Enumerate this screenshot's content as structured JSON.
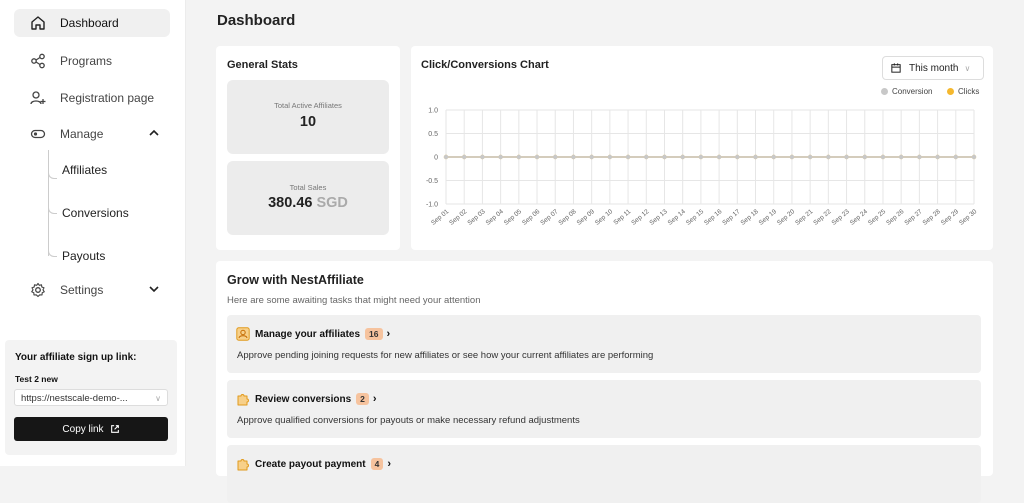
{
  "nav": {
    "dashboard": "Dashboard",
    "programs": "Programs",
    "registration": "Registration page",
    "manage": "Manage",
    "affiliates": "Affiliates",
    "conversions": "Conversions",
    "payouts": "Payouts",
    "settings": "Settings"
  },
  "signup": {
    "title": "Your affiliate sign up link:",
    "program": "Test 2 new",
    "link": "https://nestscale-demo-...",
    "copy_label": "Copy link"
  },
  "page": {
    "title": "Dashboard"
  },
  "stats": {
    "title": "General Stats",
    "active_label": "Total Active Affiliates",
    "active_value": "10",
    "sales_label": "Total Sales",
    "sales_value": "380.46",
    "sales_currency": "SGD"
  },
  "chart": {
    "title": "Click/Conversions Chart",
    "range": "This month",
    "legend_conversion": "Conversion",
    "legend_clicks": "Clicks"
  },
  "chart_data": {
    "type": "line",
    "x": [
      "Sep 01",
      "Sep 02",
      "Sep 03",
      "Sep 04",
      "Sep 05",
      "Sep 06",
      "Sep 07",
      "Sep 08",
      "Sep 09",
      "Sep 10",
      "Sep 11",
      "Sep 12",
      "Sep 13",
      "Sep 14",
      "Sep 15",
      "Sep 16",
      "Sep 17",
      "Sep 18",
      "Sep 19",
      "Sep 20",
      "Sep 21",
      "Sep 22",
      "Sep 23",
      "Sep 24",
      "Sep 25",
      "Sep 26",
      "Sep 27",
      "Sep 28",
      "Sep 29",
      "Sep 30"
    ],
    "series": [
      {
        "name": "Conversion",
        "values": [
          0,
          0,
          0,
          0,
          0,
          0,
          0,
          0,
          0,
          0,
          0,
          0,
          0,
          0,
          0,
          0,
          0,
          0,
          0,
          0,
          0,
          0,
          0,
          0,
          0,
          0,
          0,
          0,
          0,
          0
        ]
      },
      {
        "name": "Clicks",
        "values": [
          0,
          0,
          0,
          0,
          0,
          0,
          0,
          0,
          0,
          0,
          0,
          0,
          0,
          0,
          0,
          0,
          0,
          0,
          0,
          0,
          0,
          0,
          0,
          0,
          0,
          0,
          0,
          0,
          0,
          0
        ]
      }
    ],
    "y_ticks": [
      "1.0",
      "0.5",
      "0",
      "-0.5",
      "-1.0"
    ],
    "ylim": [
      -1,
      1
    ],
    "grid": true,
    "legend": "top-right"
  },
  "grow": {
    "title": "Grow with NestAffiliate",
    "subtitle": "Here are some awaiting tasks that might need your attention",
    "tasks": [
      {
        "title": "Manage your affiliates",
        "count": "16",
        "desc": "Approve pending joining requests for new affiliates or see how your current affiliates are performing"
      },
      {
        "title": "Review conversions",
        "count": "2",
        "desc": "Approve qualified conversions for payouts or make necessary refund adjustments"
      },
      {
        "title": "Create payout payment",
        "count": "4",
        "desc": ""
      }
    ]
  },
  "colors": {
    "conversion": "#c8c8c8",
    "clicks": "#f5b82e",
    "badge": "#f6c39e"
  }
}
